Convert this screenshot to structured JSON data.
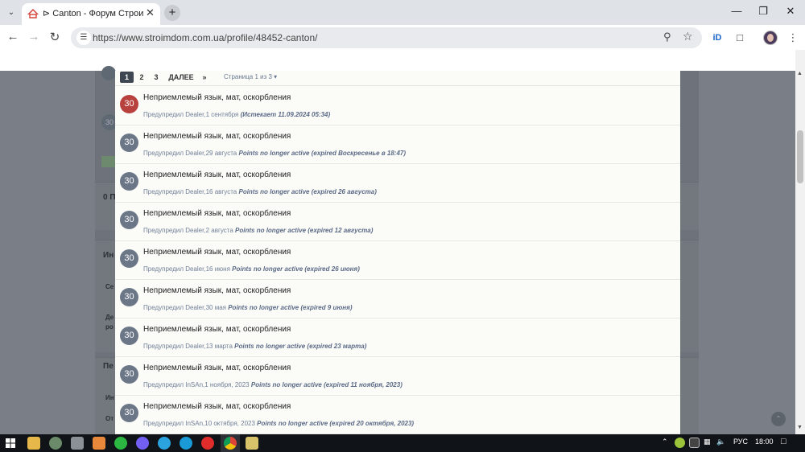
{
  "browser": {
    "tab_title": "⊳ Canton - Форум Строим Дом",
    "url": "https://www.stroimdom.com.ua/profile/48452-canton/"
  },
  "pagination": {
    "pages": [
      "1",
      "2",
      "3"
    ],
    "next_label": "ДАЛЕЕ",
    "last_label": "»",
    "status": "Страница 1 из 3 ▾"
  },
  "background": {
    "label_0": "0 П",
    "label_in": "Ин",
    "label_se": "Се",
    "label_de": "Де",
    "label_ro": "ро",
    "label_pe": "Пе",
    "label_in2": "Ин",
    "label_ot": "От",
    "badge": "30"
  },
  "warnings": [
    {
      "points": "30",
      "reason": "Неприемлемый язык, мат, оскорбления",
      "meta": "Предупредил Dealer,1 сентября",
      "status": "(Истекает 11.09.2024 05:34)",
      "highlight": true
    },
    {
      "points": "30",
      "reason": "Неприемлемый язык, мат, оскорбления",
      "meta": "Предупредил Dealer,29 августа",
      "status": "Points no longer active (expired Воскресенье в 18:47)",
      "highlight": false
    },
    {
      "points": "30",
      "reason": "Неприемлемый язык, мат, оскорбления",
      "meta": "Предупредил Dealer,16 августа",
      "status": "Points no longer active (expired 26 августа)",
      "highlight": false
    },
    {
      "points": "30",
      "reason": "Неприемлемый язык, мат, оскорбления",
      "meta": "Предупредил Dealer,2 августа",
      "status": "Points no longer active (expired 12 августа)",
      "highlight": false
    },
    {
      "points": "30",
      "reason": "Неприемлемый язык, мат, оскорбления",
      "meta": "Предупредил Dealer,16 июня",
      "status": "Points no longer active (expired 26 июня)",
      "highlight": false
    },
    {
      "points": "30",
      "reason": "Неприемлемый язык, мат, оскорбления",
      "meta": "Предупредил Dealer,30 мая",
      "status": "Points no longer active (expired 9 июня)",
      "highlight": false
    },
    {
      "points": "30",
      "reason": "Неприемлемый язык, мат, оскорбления",
      "meta": "Предупредил Dealer,13 марта",
      "status": "Points no longer active (expired 23 марта)",
      "highlight": false
    },
    {
      "points": "30",
      "reason": "Неприемлемый язык, мат, оскорбления",
      "meta": "Предупредил InSAn,1 ноября, 2023",
      "status": "Points no longer active (expired 11 ноября, 2023)",
      "highlight": false
    },
    {
      "points": "30",
      "reason": "Неприемлемый язык, мат, оскорбления",
      "meta": "Предупредил InSAn,10 октября, 2023",
      "status": "Points no longer active (expired 20 октября, 2023)",
      "highlight": false
    }
  ],
  "taskbar": {
    "language": "РУС",
    "time": "18:00"
  },
  "colors": {
    "active_badge": "#b8413d",
    "badge": "#6b7686",
    "overlay": "#7a7f87"
  }
}
